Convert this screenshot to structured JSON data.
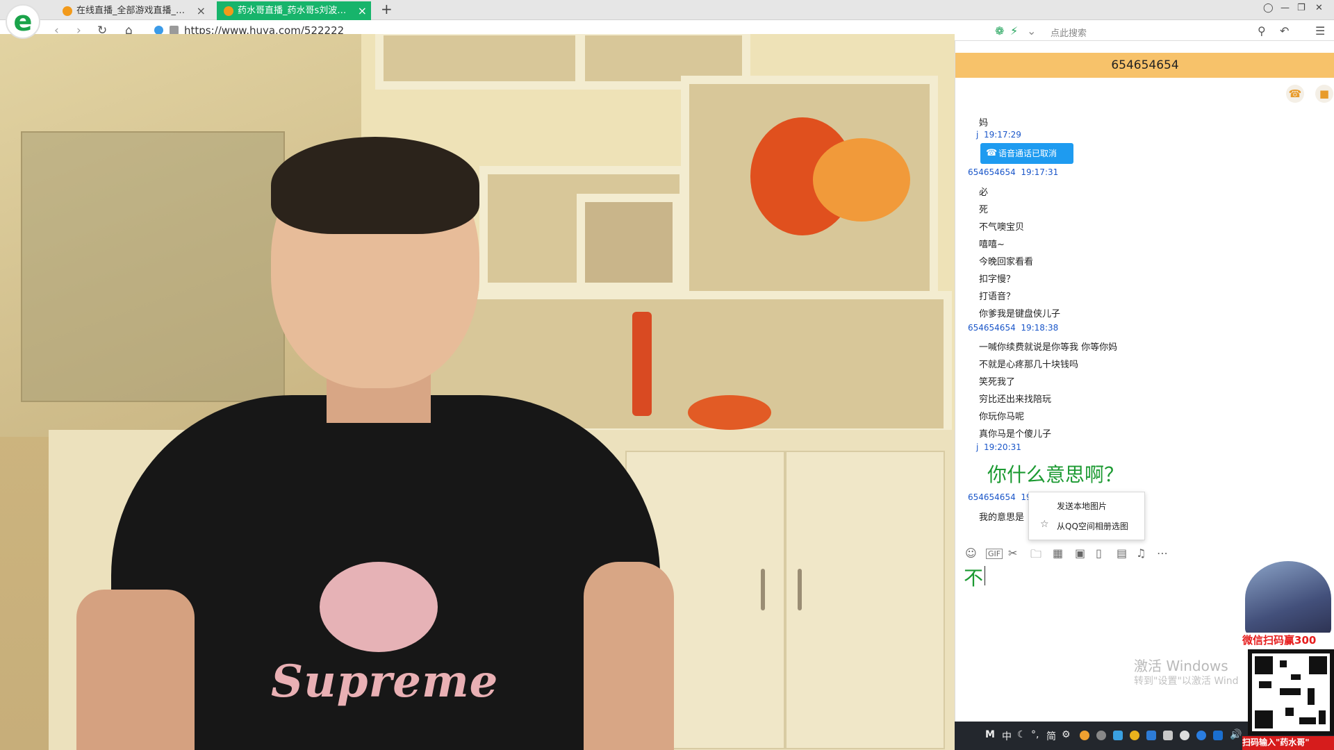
{
  "browser": {
    "tabs": [
      {
        "label": "在线直播_全部游戏直播_网络游"
      },
      {
        "label": "药水哥直播_药水哥s刘波直播间"
      }
    ],
    "url": "https://www.huya.com/522222",
    "search_placeholder": "点此搜索",
    "new_tab": "+",
    "close": "×"
  },
  "chat": {
    "contact": "654654654",
    "messages": [
      {
        "kind": "text",
        "text": "妈"
      },
      {
        "kind": "meta",
        "sender": "j",
        "time": "19:17:29"
      },
      {
        "kind": "call",
        "text": "语音通话已取消"
      },
      {
        "kind": "meta",
        "sender": "654654654",
        "time": "19:17:31"
      },
      {
        "kind": "text",
        "text": "必"
      },
      {
        "kind": "text",
        "text": "死"
      },
      {
        "kind": "text",
        "text": "不气噢宝贝"
      },
      {
        "kind": "text",
        "text": "嘻嘻~"
      },
      {
        "kind": "text",
        "text": "今晚回家看看"
      },
      {
        "kind": "text",
        "text": "扣字慢？"
      },
      {
        "kind": "text",
        "text": "打语音？"
      },
      {
        "kind": "text",
        "text": "你爹我是键盘侠儿子"
      },
      {
        "kind": "meta",
        "sender": "654654654",
        "time": "19:18:38"
      },
      {
        "kind": "text",
        "text": "一喊你续费就说是你等我 你等你妈"
      },
      {
        "kind": "text",
        "text": "不就是心疼那几十块钱吗"
      },
      {
        "kind": "text",
        "text": "笑死我了"
      },
      {
        "kind": "text",
        "text": "穷比还出来找陪玩"
      },
      {
        "kind": "text",
        "text": "你玩你马呢"
      },
      {
        "kind": "text",
        "text": "真你马是个傻儿子"
      },
      {
        "kind": "meta",
        "sender": "j",
        "time": "19:20:31"
      }
    ],
    "big_message": "你什么意思啊？",
    "last_meta_sender": "654654654",
    "last_meta_time": "19:",
    "last_text": "我的意思是",
    "context_menu": [
      "发送本地图片",
      "从QQ空间相册选图"
    ],
    "input_text": "不"
  },
  "watermark": {
    "line1": "激活 Windows",
    "line2": "转到\"设置\"以激活 Wind"
  },
  "taskbar": {
    "ime_items": [
      "M",
      "中",
      "简"
    ]
  },
  "ad": {
    "top_text": "微信扫码赢300",
    "bottom_text": "扫码输入\"药水哥\""
  }
}
